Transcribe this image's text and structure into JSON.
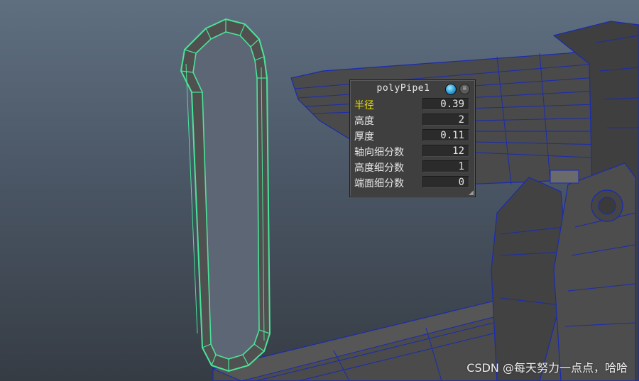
{
  "hud": {
    "title": "polyPipe1",
    "icons": {
      "ball": "shading-sphere-icon",
      "menu": "menu-icon"
    },
    "accent_active": "#f2e300",
    "rows": [
      {
        "label": "半径",
        "value": "0.39",
        "active": true
      },
      {
        "label": "高度",
        "value": "2",
        "active": false
      },
      {
        "label": "厚度",
        "value": "0.11",
        "active": false
      },
      {
        "label": "轴向细分数",
        "value": "12",
        "active": false
      },
      {
        "label": "高度细分数",
        "value": "1",
        "active": false
      },
      {
        "label": "端面细分数",
        "value": "0",
        "active": false
      }
    ]
  },
  "watermark": "CSDN @每天努力一点点，哈哈",
  "colors": {
    "selection": "#4be39a",
    "wireframe": "#1a2bb0",
    "mesh": "#4c4c4c"
  }
}
